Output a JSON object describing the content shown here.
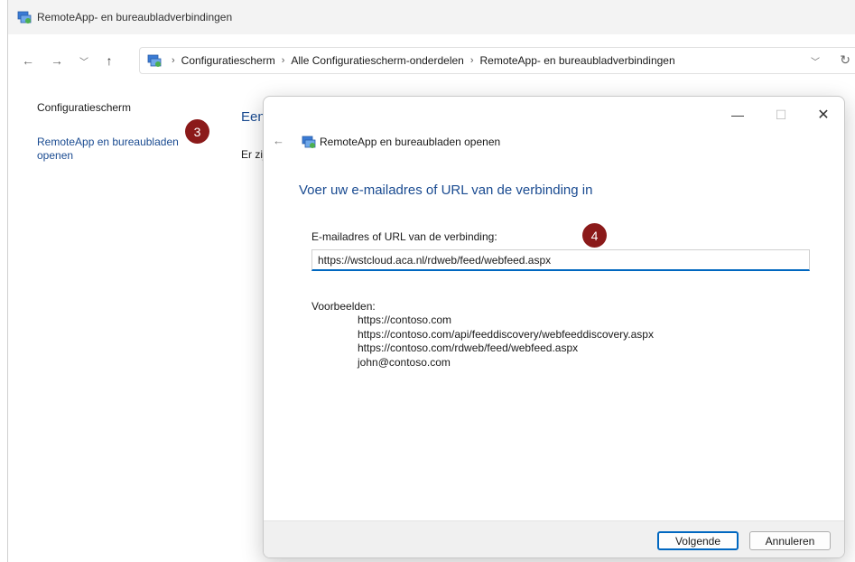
{
  "window": {
    "title": "RemoteApp- en bureaubladverbindingen",
    "app_icon": "remoteapp-icon"
  },
  "navigation": {
    "back_icon": "arrow-left-icon",
    "forward_icon": "arrow-right-icon",
    "recent_icon": "chevron-down-icon",
    "up_icon": "arrow-up-icon",
    "breadcrumbs": [
      "Configuratiescherm",
      "Alle Configuratiescherm-onderdelen",
      "RemoteApp- en bureaubladverbindingen"
    ],
    "refresh_icon": "refresh-icon"
  },
  "sidebar": {
    "items": [
      {
        "label": "Configuratiescherm"
      },
      {
        "label": "RemoteApp en bureaubladen openen"
      }
    ]
  },
  "content": {
    "heading_partial": "Een v",
    "text_partial": "Er zijn"
  },
  "badges": {
    "step3": "3",
    "step4": "4",
    "color": "#8b1a1a"
  },
  "dialog": {
    "title": "RemoteApp en bureaubladen openen",
    "heading": "Voer uw e-mailadres of URL van de verbinding in",
    "field_label": "E-mailadres of URL van de verbinding:",
    "field_value": "https://wstcloud.aca.nl/rdweb/feed/webfeed.aspx",
    "examples_label": "Voorbeelden:",
    "examples": [
      "https://contoso.com",
      "https://contoso.com/api/feeddiscovery/webfeeddiscovery.aspx",
      "https://contoso.com/rdweb/feed/webfeed.aspx",
      "john@contoso.com"
    ],
    "next_label": "Volgende",
    "cancel_label": "Annuleren",
    "accent_color": "#0067c0",
    "heading_color": "#1a4b91"
  }
}
